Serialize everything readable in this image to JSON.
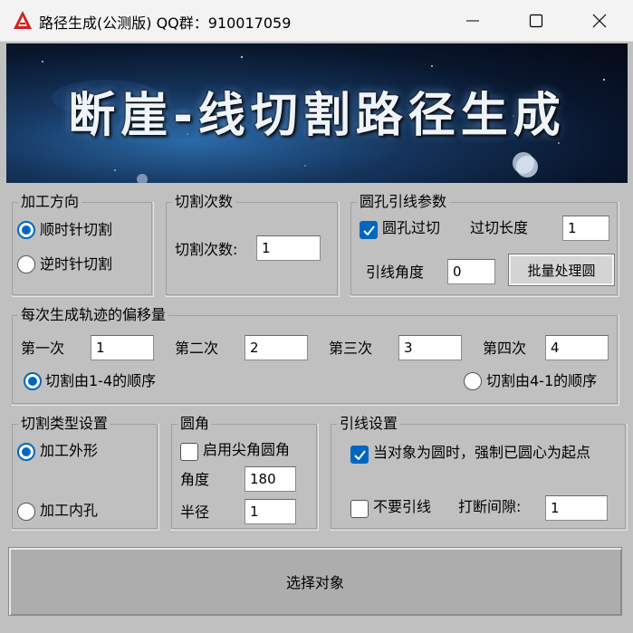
{
  "window": {
    "title": "路径生成(公测版) QQ群：910017059"
  },
  "banner": {
    "title": "断崖-线切割路径生成"
  },
  "direction": {
    "title": "加工方向",
    "cw_label": "顺时针切割",
    "ccw_label": "逆时针切割",
    "selected": "cw"
  },
  "cut_count": {
    "title": "切割次数",
    "label": "切割次数:",
    "value": "1"
  },
  "hole_lead": {
    "title": "圆孔引线参数",
    "overcut_label": "圆孔过切",
    "overcut_checked": true,
    "overcut_len_label": "过切长度",
    "overcut_len_value": "1",
    "angle_label": "引线角度",
    "angle_value": "0",
    "batch_button": "批量处理圆"
  },
  "offsets": {
    "title": "每次生成轨迹的偏移量",
    "first_label": "第一次",
    "first_value": "1",
    "second_label": "第二次",
    "second_value": "2",
    "third_label": "第三次",
    "third_value": "3",
    "fourth_label": "第四次",
    "fourth_value": "4",
    "order_14_label": "切割由1-4的顺序",
    "order_41_label": "切割由4-1的顺序",
    "selected": "1-4"
  },
  "cut_type": {
    "title": "切割类型设置",
    "outer_label": "加工外形",
    "inner_label": "加工内孔",
    "selected": "outer"
  },
  "fillet": {
    "title": "圆角",
    "enable_label": "启用尖角圆角",
    "enable_checked": false,
    "angle_label": "角度",
    "angle_value": "180",
    "radius_label": "半径",
    "radius_value": "1"
  },
  "lead_settings": {
    "title": "引线设置",
    "force_center_label": "当对象为圆时，强制已圆心为起点",
    "force_center_checked": true,
    "no_lead_label": "不要引线",
    "no_lead_checked": false,
    "break_gap_label": "打断间隙:",
    "break_gap_value": "1"
  },
  "select_button": "选择对象",
  "colors": {
    "accent": "#0067c0",
    "background": "#c0c0c0",
    "titlebar": "#f3f3f3"
  }
}
